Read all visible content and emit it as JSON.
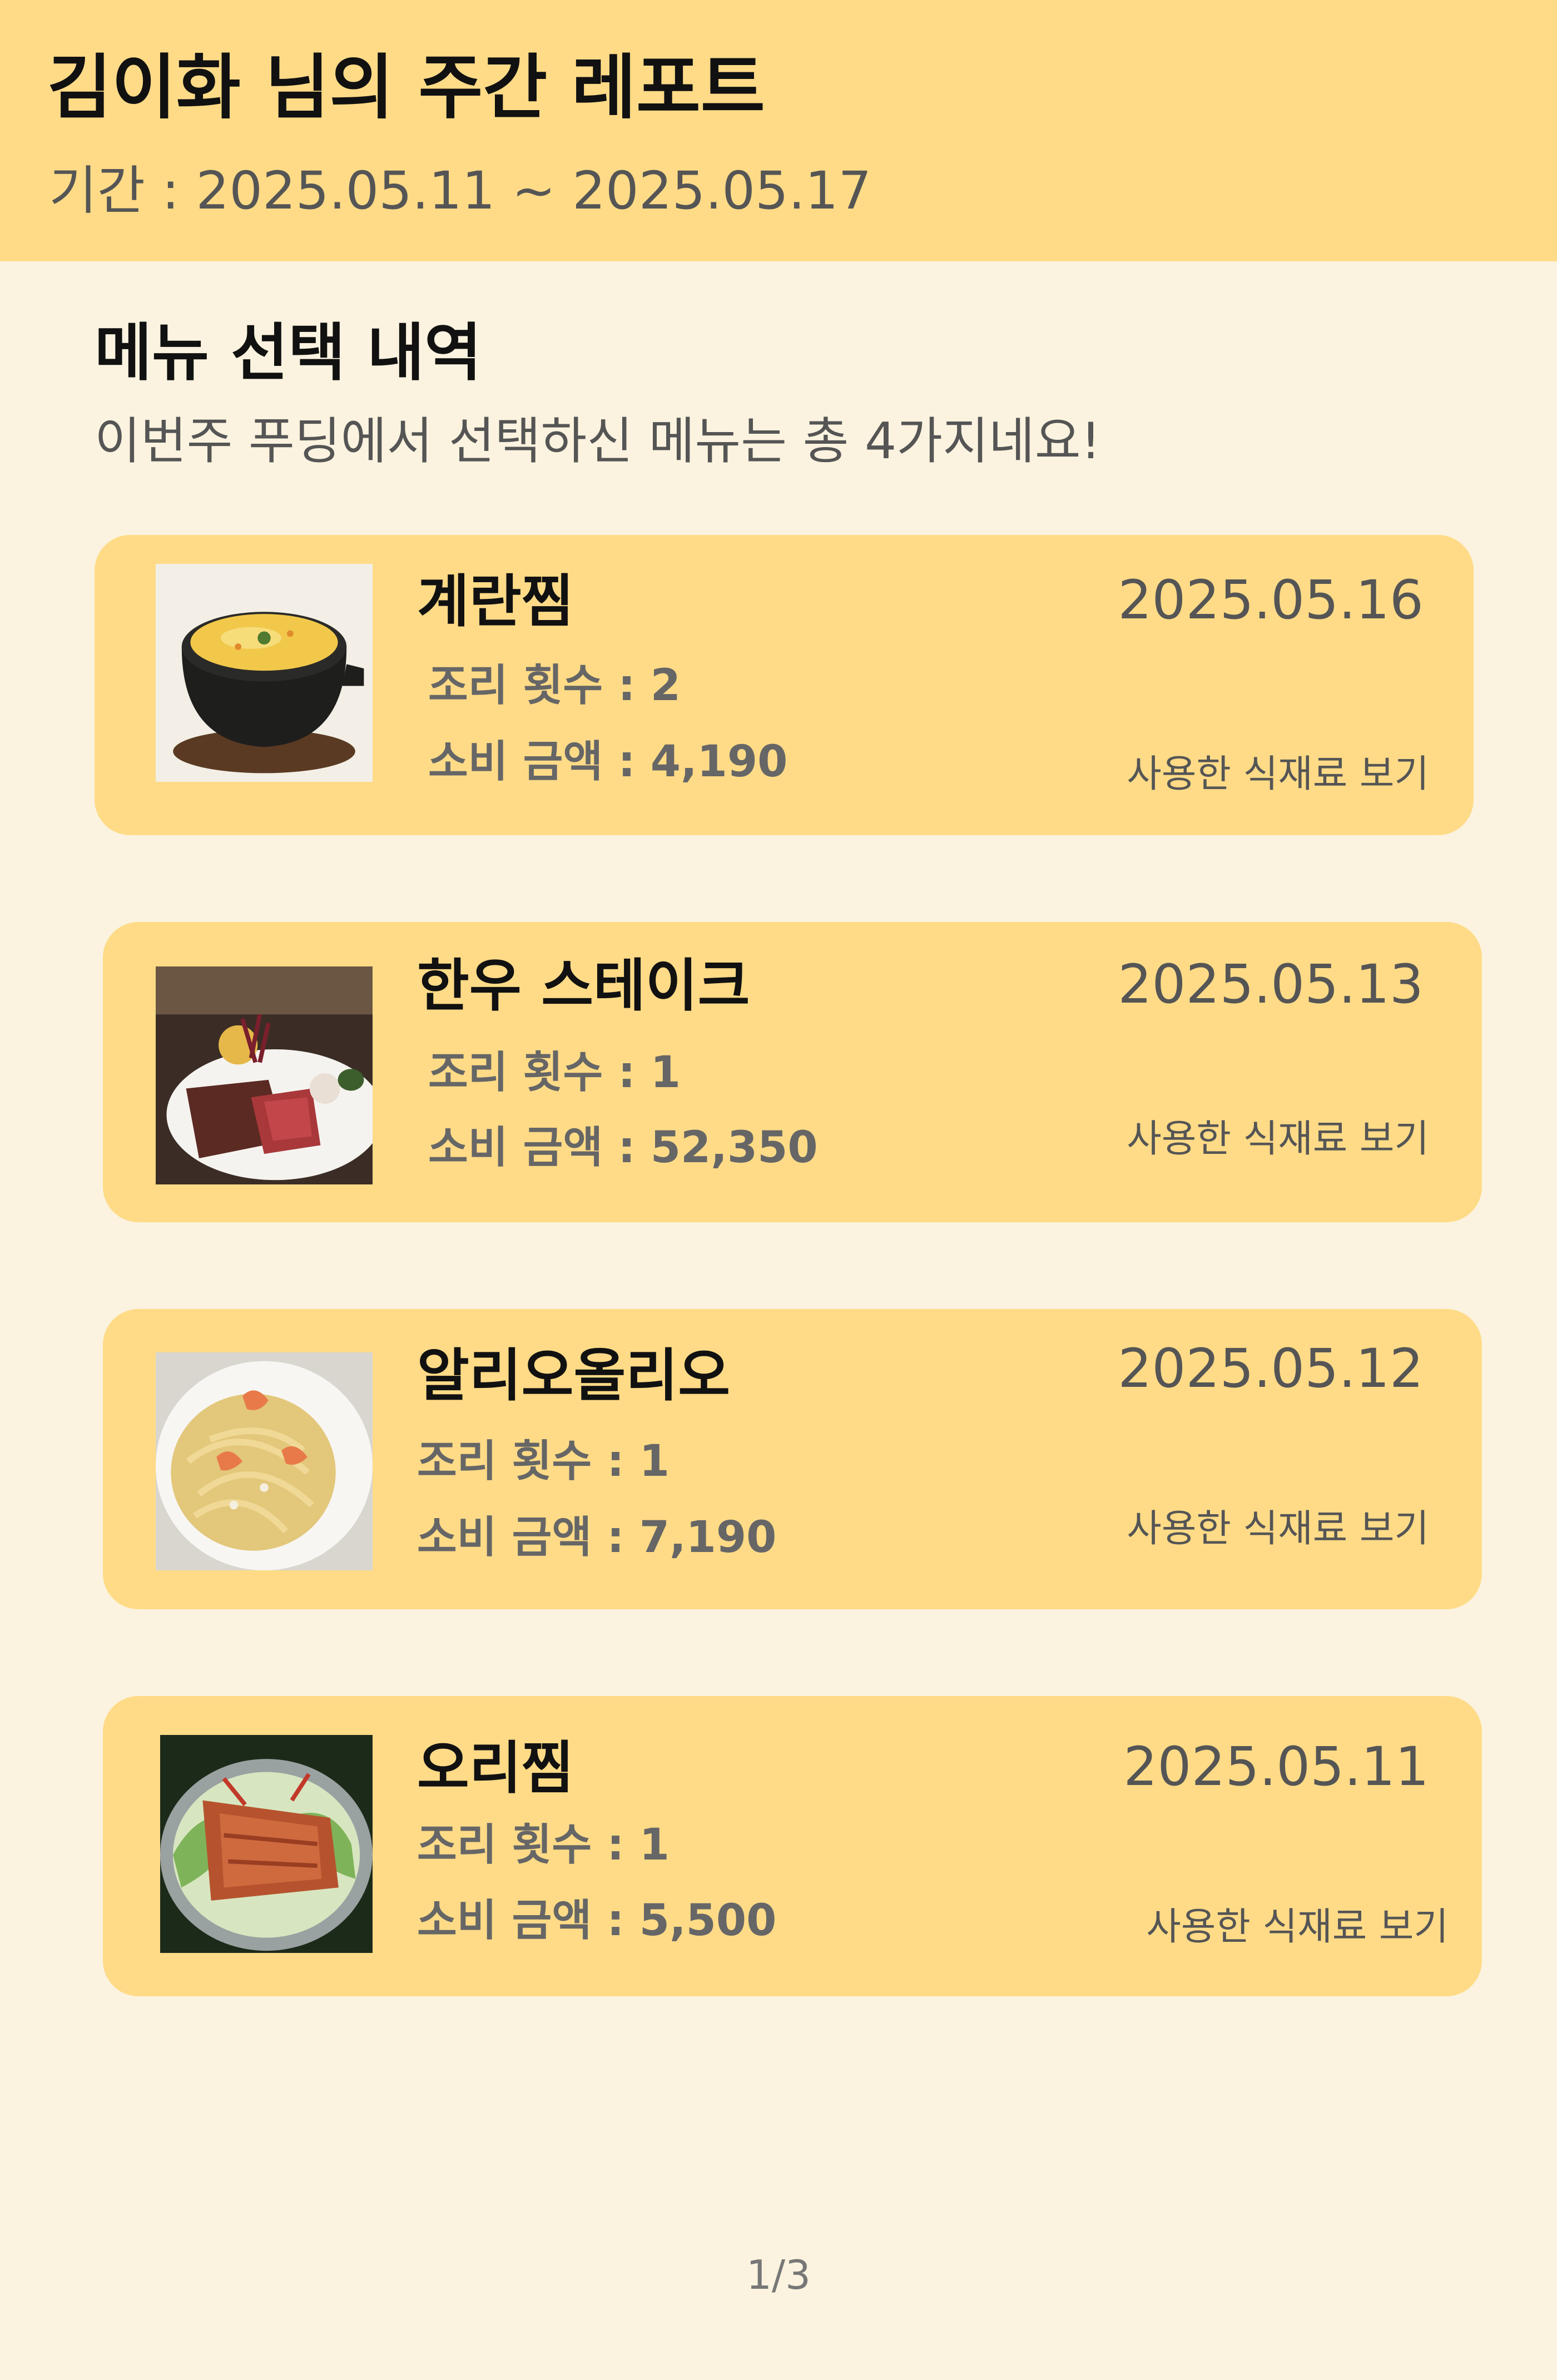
{
  "header": {
    "title": "김이화 님의 주간 레포트",
    "period": "기간 : 2025.05.11 ~ 2025.05.17"
  },
  "section": {
    "title": "메뉴 선택 내역",
    "subtitle": "이번주 푸딩에서 선택하신 메뉴는 총 4가지네요!"
  },
  "menus": [
    {
      "name": "계란찜",
      "date": "2025.05.16",
      "count_text": "조리 횟수 : 2",
      "spend_text": "소비 금액 : 4,190",
      "link_label": "사용한 식재료 보기",
      "image_icon": "steamed-egg-photo"
    },
    {
      "name": "한우 스테이크",
      "date": "2025.05.13",
      "count_text": "조리 횟수 : 1",
      "spend_text": "소비 금액 : 52,350",
      "link_label": "사용한 식재료 보기",
      "image_icon": "steak-photo"
    },
    {
      "name": "알리오올리오",
      "date": "2025.05.12",
      "count_text": "조리 횟수 : 1",
      "spend_text": "소비 금액 : 7,190",
      "link_label": "사용한 식재료 보기",
      "image_icon": "pasta-photo"
    },
    {
      "name": "오리찜",
      "date": "2025.05.11",
      "count_text": "조리 횟수 : 1",
      "spend_text": "소비 금액 : 5,500",
      "link_label": "사용한 식재료 보기",
      "image_icon": "duck-photo"
    }
  ],
  "pager": "1/3",
  "colors": {
    "header_bg": "#FFDB87",
    "page_bg": "#FBF3DF",
    "card_bg": "#FFDB87"
  }
}
